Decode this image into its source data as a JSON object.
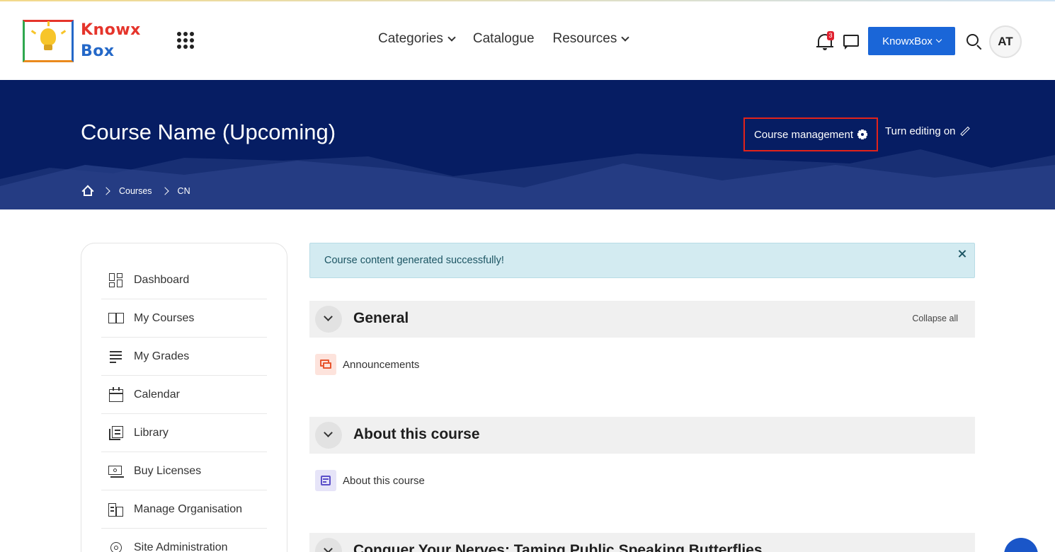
{
  "header": {
    "logo_line1": "Knowx",
    "logo_line2": "Box",
    "nav": [
      {
        "label": "Categories",
        "has_dropdown": true
      },
      {
        "label": "Catalogue",
        "has_dropdown": false
      },
      {
        "label": "Resources",
        "has_dropdown": true
      }
    ],
    "notification_count": "3",
    "account_button": "KnowxBox",
    "avatar_initials": "AT"
  },
  "banner": {
    "course_title": "Course Name (Upcoming)",
    "course_management": "Course management",
    "turn_editing": "Turn editing on",
    "breadcrumb": [
      "Courses",
      "CN"
    ]
  },
  "sidebar": {
    "items": [
      {
        "label": "Dashboard",
        "icon": "dashboard-icon"
      },
      {
        "label": "My Courses",
        "icon": "book-icon"
      },
      {
        "label": "My Grades",
        "icon": "grades-icon"
      },
      {
        "label": "Calendar",
        "icon": "calendar-icon"
      },
      {
        "label": "Library",
        "icon": "library-icon"
      },
      {
        "label": "Buy Licenses",
        "icon": "licenses-icon"
      },
      {
        "label": "Manage Organisation",
        "icon": "organisation-icon"
      },
      {
        "label": "Site Administration",
        "icon": "gear-icon"
      }
    ]
  },
  "main": {
    "alert": "Course content generated successfully!",
    "sections": [
      {
        "title": "General",
        "collapse_label": "Collapse all",
        "activity": "Announcements"
      },
      {
        "title": "About this course",
        "activity": "About this course"
      },
      {
        "title": "Conquer Your Nerves: Taming Public Speaking Butterflies"
      }
    ]
  },
  "colors": {
    "banner": "#061d63",
    "primary_button": "#1a66d8",
    "highlight_border": "#e2231a",
    "alert_bg": "#d3ebf1"
  }
}
